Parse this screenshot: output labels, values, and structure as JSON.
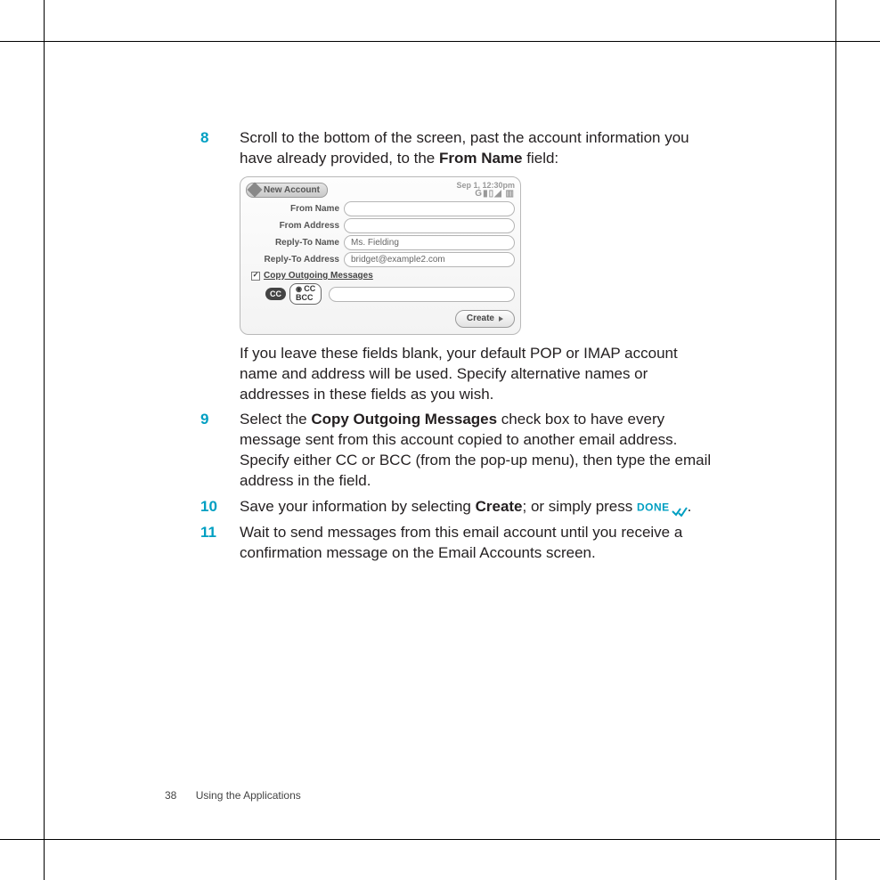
{
  "steps": {
    "s8": {
      "num": "8",
      "text_a": "Scroll to the bottom of the screen, past the account information you have already provided, to the ",
      "bold_a": "From Name",
      "text_b": " field:",
      "after_a": "If you leave these fields blank, your default POP or IMAP account name and address will be used. Specify alternative names or addresses in these fields as you wish."
    },
    "s9": {
      "num": "9",
      "text_a": "Select the ",
      "bold_a": "Copy Outgoing Messages",
      "text_b": " check box to have every message sent from this account copied to another email address. Specify either CC or BCC (from the pop-up menu), then type the email address in the field."
    },
    "s10": {
      "num": "10",
      "text_a": "Save your information by selecting ",
      "bold_a": "Create",
      "text_b": "; or simply press ",
      "done": "DONE",
      "text_c": "."
    },
    "s11": {
      "num": "11",
      "text_a": "Wait to send messages from this email account until you receive a confirmation message on the Email Accounts screen."
    }
  },
  "device": {
    "title": "New Account",
    "clock": "Sep 1, 12:30pm",
    "fields": {
      "from_name_label": "From Name",
      "from_name_value": "",
      "from_addr_label": "From Address",
      "from_addr_value": "",
      "reply_name_label": "Reply-To Name",
      "reply_name_value": "Ms. Fielding",
      "reply_addr_label": "Reply-To Address",
      "reply_addr_value": "bridget@example2.com"
    },
    "copy_label": "Copy Outgoing Messages",
    "cc_pill": "CC",
    "cc_opt1": "CC",
    "cc_opt2": "BCC",
    "create": "Create"
  },
  "footer": {
    "page": "38",
    "section": "Using the Applications"
  }
}
